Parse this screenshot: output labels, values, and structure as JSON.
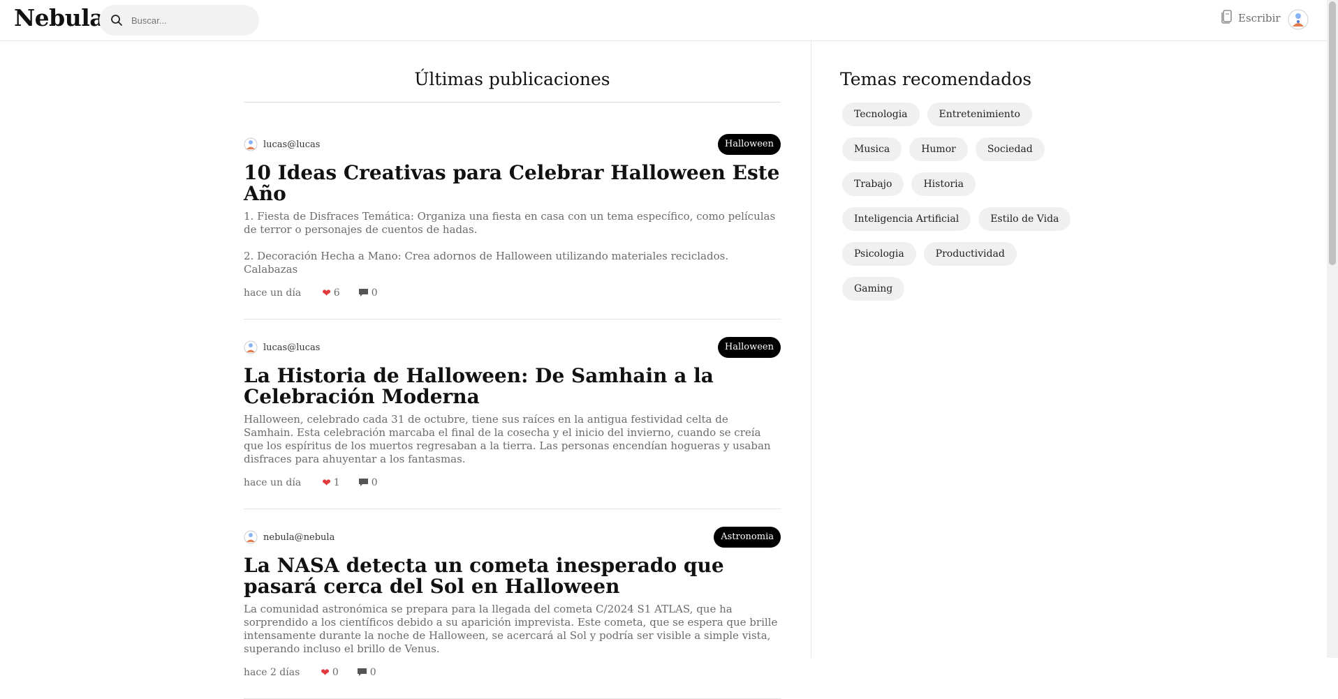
{
  "header": {
    "logo": "Nebula",
    "search_placeholder": "Buscar...",
    "write_label": "Escribir"
  },
  "feed": {
    "title": "Últimas publicaciones",
    "posts": [
      {
        "author": "lucas@lucas",
        "tag": "Halloween",
        "title": "10 Ideas Creativas para Celebrar Halloween Este Año",
        "excerpt": "1. Fiesta de Disfraces Temática: Organiza una fiesta en casa con un tema específico, como películas de terror o personajes de cuentos de hadas.\n\n2. Decoración Hecha a Mano: Crea adornos de Halloween utilizando materiales reciclados. Calabazas",
        "time": "hace un día",
        "likes": "6",
        "comments": "0"
      },
      {
        "author": "lucas@lucas",
        "tag": "Halloween",
        "title": "La Historia de Halloween: De Samhain a la Celebración Moderna",
        "excerpt": "Halloween, celebrado cada 31 de octubre, tiene sus raíces en la antigua festividad celta de Samhain. Esta celebración marcaba el final de la cosecha y el inicio del invierno, cuando se creía que los espíritus de los muertos regresaban a la tierra. Las personas encendían hogueras y usaban disfraces para ahuyentar a los fantasmas.",
        "time": "hace un día",
        "likes": "1",
        "comments": "0"
      },
      {
        "author": "nebula@nebula",
        "tag": "Astronomia",
        "title": "La NASA detecta un cometa inesperado que pasará cerca del Sol en Halloween",
        "excerpt": "La comunidad astronómica se prepara para la llegada del cometa C/2024 S1 ATLAS, que ha sorprendido a los científicos debido a su aparición imprevista. Este cometa, que se espera que brille intensamente durante la noche de Halloween, se acercará al Sol y podría ser visible a simple vista, superando incluso el brillo de Venus.",
        "time": "hace 2 días",
        "likes": "0",
        "comments": "0"
      }
    ]
  },
  "sidebar": {
    "title": "Temas recomendados",
    "topics": [
      "Tecnologia",
      "Entretenimiento",
      "Musica",
      "Humor",
      "Sociedad",
      "Trabajo",
      "Historia",
      "Inteligencia Artificial",
      "Estilo de Vida",
      "Psicologia",
      "Productividad",
      "Gaming"
    ]
  },
  "colors": {
    "accent_heart": "#e0393e",
    "tag_bg": "#000000",
    "chip_bg": "#f0f0f0"
  },
  "icons": {
    "search": "search-icon",
    "write": "document-edit-icon",
    "avatar": "avatar",
    "like": "heart-icon",
    "comment": "comment-icon"
  }
}
